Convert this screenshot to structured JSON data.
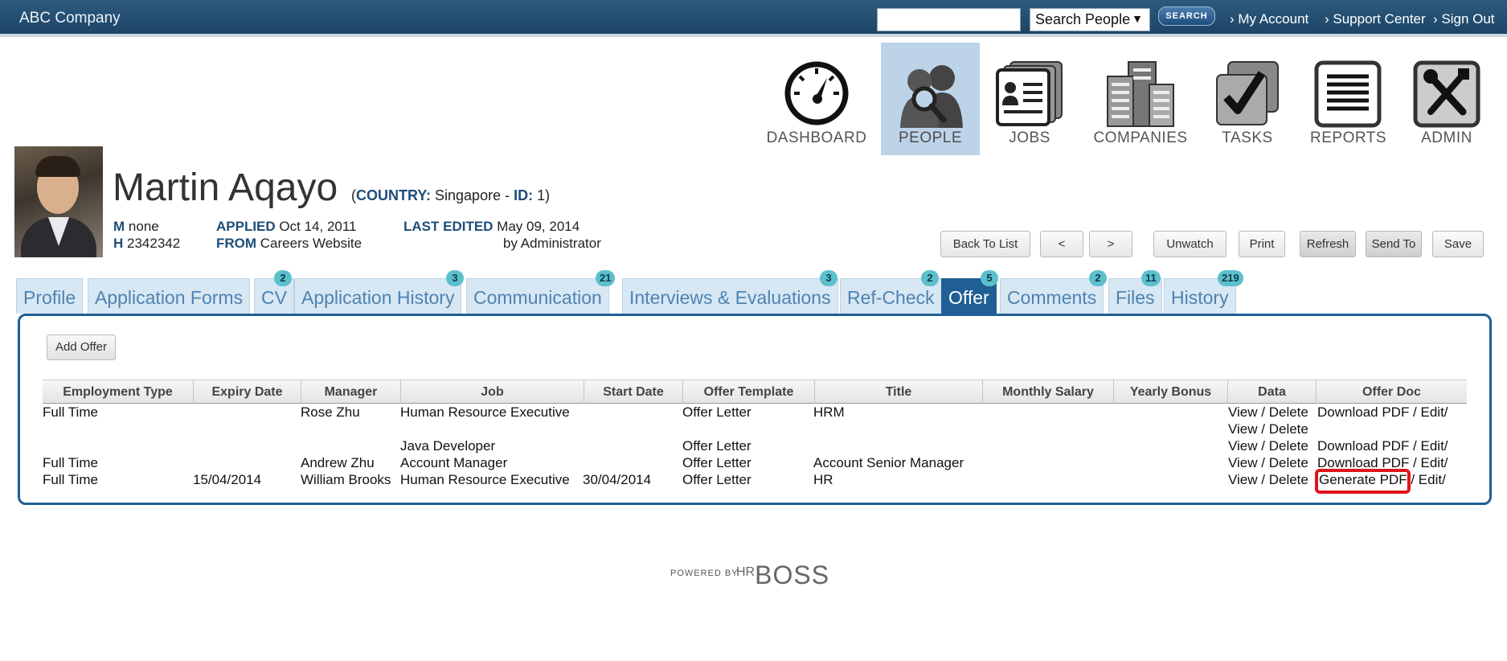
{
  "topbar": {
    "company": "ABC Company",
    "search_value": "",
    "search_scope": "Search People",
    "search_button": "SEARCH",
    "links": [
      "› My Account",
      "› Support Center",
      "› Sign Out"
    ]
  },
  "modules": [
    {
      "label": "DASHBOARD",
      "icon": "dashboard-gauge-icon",
      "active": false
    },
    {
      "label": "PEOPLE",
      "icon": "people-search-icon",
      "active": true
    },
    {
      "label": "JOBS",
      "icon": "jobs-id-card-icon",
      "active": false
    },
    {
      "label": "COMPANIES",
      "icon": "companies-buildings-icon",
      "active": false
    },
    {
      "label": "TASKS",
      "icon": "tasks-checkmark-icon",
      "active": false
    },
    {
      "label": "REPORTS",
      "icon": "reports-document-icon",
      "active": false
    },
    {
      "label": "ADMIN",
      "icon": "admin-tools-icon",
      "active": false
    }
  ],
  "candidate": {
    "name": "Martin Aqayo",
    "country_label": "COUNTRY:",
    "country": "Singapore",
    "id_label": "ID:",
    "id": "1",
    "m_label": "M",
    "m_value": "none",
    "h_label": "H",
    "h_value": "2342342",
    "applied_label": "APPLIED",
    "applied": "Oct 14, 2011",
    "from_label": "FROM",
    "from": "Careers Website",
    "last_edited_label": "LAST EDITED",
    "last_edited": "May 09, 2014",
    "edited_by": "by Administrator"
  },
  "actions": [
    "Back To List",
    "<",
    ">",
    "Unwatch",
    "Print",
    "Refresh",
    "Send To",
    "Save"
  ],
  "tabs": [
    {
      "label": "Profile",
      "badge": ""
    },
    {
      "label": "Application Forms",
      "badge": ""
    },
    {
      "label": "CV",
      "badge": "2"
    },
    {
      "label": "Application History",
      "badge": "3"
    },
    {
      "label": "Communication",
      "badge": "21"
    },
    {
      "label": "Interviews & Evaluations",
      "badge": "3"
    },
    {
      "label": "Ref-Check",
      "badge": "2"
    },
    {
      "label": "Offer",
      "badge": "5"
    },
    {
      "label": "Comments",
      "badge": "2"
    },
    {
      "label": "Files",
      "badge": "11"
    },
    {
      "label": "History",
      "badge": "219"
    }
  ],
  "offer": {
    "add_button": "Add Offer",
    "columns": [
      "Employment Type",
      "Expiry Date",
      "Manager",
      "Job",
      "Start Date",
      "Offer Template",
      "Title",
      "Monthly Salary",
      "Yearly Bonus",
      "Data",
      "Offer Doc"
    ],
    "rows": [
      {
        "type": "Full Time",
        "expiry": "",
        "manager": "Rose Zhu",
        "job": "Human Resource Executive",
        "start": "",
        "template": "Offer Letter",
        "title": "HRM",
        "salary": "",
        "bonus": "",
        "data": "View / Delete",
        "doc": "Download PDF / Edit/"
      },
      {
        "type": "",
        "expiry": "",
        "manager": "",
        "job": "",
        "start": "",
        "template": "",
        "title": "",
        "salary": "",
        "bonus": "",
        "data": "View / Delete",
        "doc": ""
      },
      {
        "type": "",
        "expiry": "",
        "manager": "",
        "job": "Java Developer",
        "start": "",
        "template": "Offer Letter",
        "title": "",
        "salary": "",
        "bonus": "",
        "data": "View / Delete",
        "doc": "Download PDF / Edit/"
      },
      {
        "type": "Full Time",
        "expiry": "",
        "manager": "Andrew Zhu",
        "job": "Account Manager",
        "start": "",
        "template": "Offer Letter",
        "title": "Account Senior Manager",
        "salary": "",
        "bonus": "",
        "data": "View / Delete",
        "doc": "Download PDF / Edit/"
      },
      {
        "type": "Full Time",
        "expiry": "15/04/2014",
        "manager": "William Brooks",
        "job": "Human Resource Executive",
        "start": "30/04/2014",
        "template": "Offer Letter",
        "title": "HR",
        "salary": "",
        "bonus": "",
        "data": "View / Delete",
        "doc": "Generate PDF / Edit/"
      }
    ]
  },
  "footer": {
    "powered": "POWERED BY",
    "brand_hr": "HR",
    "brand": "BOSS"
  },
  "colors": {
    "topbar": "#1c4566",
    "accent": "#1f5f95",
    "tab_inactive": "#d7e7f4",
    "badge": "#5cc0cc",
    "highlight": "#e0141b"
  }
}
